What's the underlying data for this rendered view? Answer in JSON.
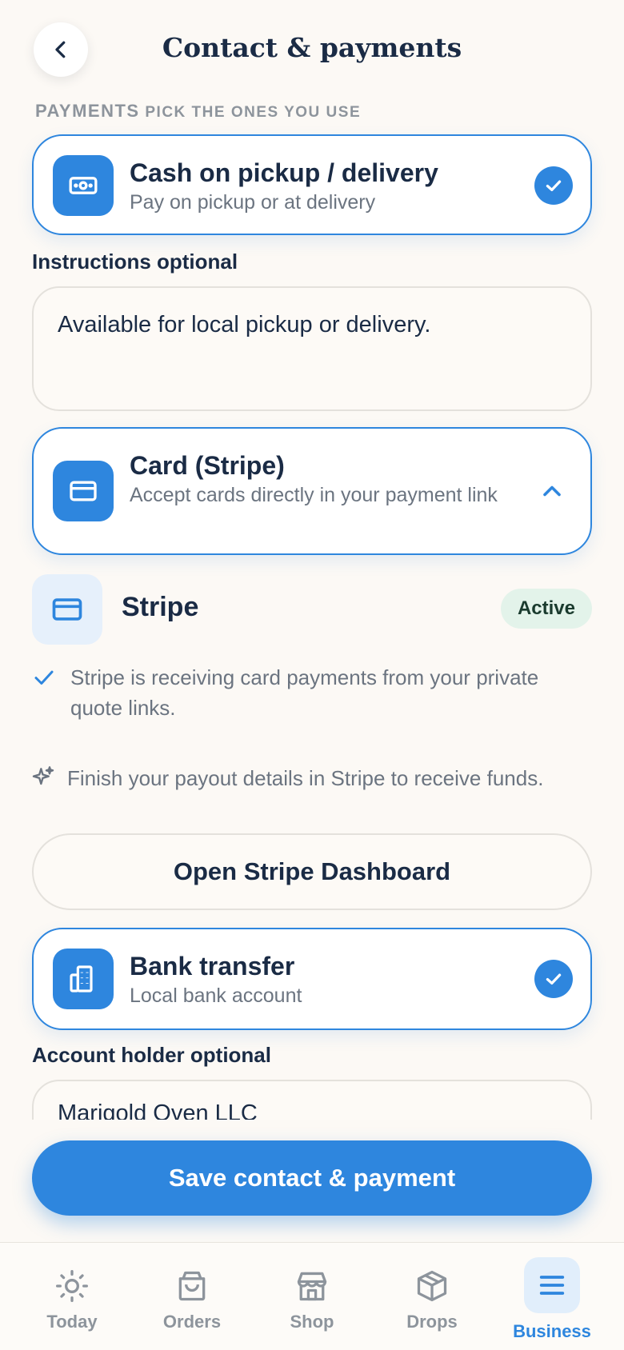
{
  "header": {
    "title": "Contact & payments",
    "back_icon": "chevron-left-icon"
  },
  "section": {
    "label_main": "Payments",
    "label_hint": "pick the ones you use"
  },
  "cash": {
    "title": "Cash on pickup / delivery",
    "subtitle": "Pay on pickup or at delivery",
    "icon": "cash-icon",
    "selected": true,
    "instructions_label": "Instructions optional",
    "instructions_value": "Available for local pickup or delivery."
  },
  "card": {
    "title": "Card (Stripe)",
    "subtitle": "Accept cards directly in your payment link",
    "icon": "credit-card-icon",
    "expanded": true
  },
  "stripe": {
    "name": "Stripe",
    "status": "Active",
    "receiving_text": "Stripe is receiving card payments from your private quote links.",
    "payout_text": "Finish your payout details in Stripe to receive funds.",
    "dashboard_button": "Open Stripe Dashboard"
  },
  "bank": {
    "title": "Bank transfer",
    "subtitle": "Local bank account",
    "icon": "bank-building-icon",
    "selected": true,
    "holder_label": "Account holder optional",
    "holder_value": "Marigold Oven LLC"
  },
  "save_button": "Save contact & payment",
  "tabs": [
    {
      "label": "Today",
      "icon": "sun-icon",
      "active": false
    },
    {
      "label": "Orders",
      "icon": "shopping-bag-icon",
      "active": false
    },
    {
      "label": "Shop",
      "icon": "storefront-icon",
      "active": false
    },
    {
      "label": "Drops",
      "icon": "box-icon",
      "active": false
    },
    {
      "label": "Business",
      "icon": "menu-icon",
      "active": true
    }
  ],
  "colors": {
    "accent": "#2e86de",
    "background": "#fcf9f5",
    "text": "#1a2b45",
    "muted": "#6b7480",
    "badge_bg": "#e3f3ea"
  }
}
